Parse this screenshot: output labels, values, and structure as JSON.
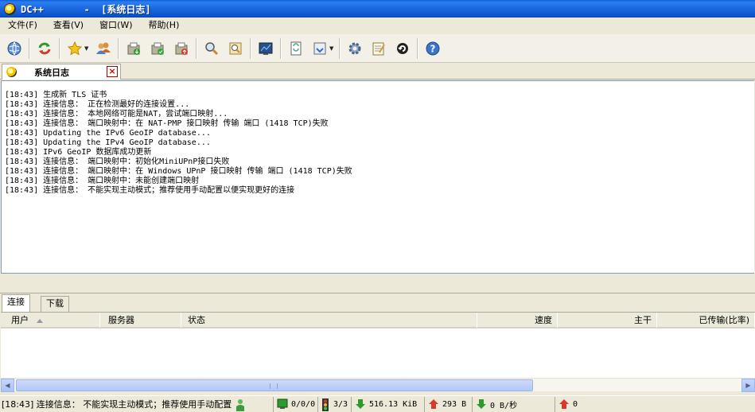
{
  "window": {
    "app_name": "DC++",
    "title_suffix": "       -  [系统日志]"
  },
  "menu": [
    {
      "label": "文件(F)"
    },
    {
      "label": "查看(V)"
    },
    {
      "label": "窗口(W)"
    },
    {
      "label": "帮助(H)"
    }
  ],
  "toolbar": {
    "icons": [
      "connect-globe-icon",
      "reconnect-icon",
      "favorites-star-icon",
      "users-icon",
      "download-queue-icon",
      "finished-downloads-icon",
      "upload-queue-icon",
      "search-icon",
      "adl-search-icon",
      "search-spy-icon",
      "open-file-list-icon",
      "refresh-share-icon",
      "settings-gear-icon",
      "notepad-icon",
      "away-icon",
      "help-icon"
    ]
  },
  "tabs": {
    "system_log": {
      "label": "系统日志"
    }
  },
  "log": [
    "[18:43] 生成新 TLS 证书",
    "[18:43] 连接信息： 正在检测最好的连接设置...",
    "[18:43] 连接信息： 本地网络可能是NAT，尝试端口映射...",
    "[18:43] 连接信息： 端口映射中：在 NAT-PMP 接口映射 传输 端口 (1418 TCP)失败",
    "[18:43] Updating the IPv6 GeoIP database...",
    "[18:43] Updating the IPv4 GeoIP database...",
    "[18:43] IPv6 GeoIP 数据库成功更新",
    "[18:43] 连接信息： 端口映射中：初始化MiniUPnP接口失败",
    "[18:43] 连接信息： 端口映射中：在 Windows UPnP 接口映射 传输 端口 (1418 TCP)失败",
    "[18:43] 连接信息： 端口映射中：未能创建端口映射",
    "[18:43] 连接信息： 不能实现主动模式；推荐使用手动配置以便实现更好的连接"
  ],
  "bottom_tabs": [
    {
      "label": "连接"
    },
    {
      "label": "下载"
    }
  ],
  "columns": {
    "user": "用户",
    "hub": "服务器",
    "status": "状态",
    "speed": "速度",
    "chunk": "主干",
    "transferred": "已传输(比率)"
  },
  "status": {
    "message": "[18:43] 连接信息： 不能实现主动模式；推荐使用手动配置",
    "hubs": "0/0/0",
    "slots": "3/3",
    "downloaded": "516.13 KiB",
    "uploaded": "293 B",
    "down_speed": "0 B/秒",
    "up_speed": "0"
  }
}
